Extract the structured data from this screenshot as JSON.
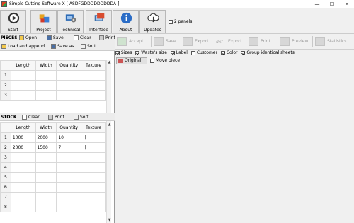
{
  "window": {
    "title": "Simple Cutting Software X [ ASDFGDDDDDDDDDA ]",
    "minimize": "—",
    "maximize": "☐",
    "close": "✕"
  },
  "ribbon": {
    "buttons": [
      {
        "label": "Start",
        "icon": "play-icon"
      },
      {
        "label": "Project",
        "icon": "project-icon"
      },
      {
        "label": "Technical",
        "icon": "technical-icon"
      },
      {
        "label": "Interface",
        "icon": "interface-icon"
      },
      {
        "label": "About",
        "icon": "info-icon"
      },
      {
        "label": "Updates",
        "icon": "cloud-update-icon"
      }
    ],
    "two_panels_label": "2 panels"
  },
  "pieces": {
    "section_label": "PIECES",
    "toolbar": {
      "open": "Open",
      "save": "Save",
      "clear": "Clear",
      "print": "Print",
      "load_append": "Load and append",
      "save_as": "Save as",
      "sort": "Sort"
    },
    "columns": [
      "Length",
      "Width",
      "Quantity",
      "Texture"
    ],
    "rows": [
      {
        "num": "1",
        "length": "",
        "width": "",
        "quantity": "",
        "texture": ""
      },
      {
        "num": "2",
        "length": "",
        "width": "",
        "quantity": "",
        "texture": ""
      },
      {
        "num": "3",
        "length": "",
        "width": "",
        "quantity": "",
        "texture": ""
      }
    ]
  },
  "stock": {
    "section_label": "STOCK",
    "toolbar": {
      "clear": "Clear",
      "print": "Print",
      "sort": "Sort"
    },
    "columns": [
      "Length",
      "Width",
      "Quantity",
      "Texture"
    ],
    "rows": [
      {
        "num": "1",
        "length": "1000",
        "width": "2000",
        "quantity": "10",
        "texture": "||"
      },
      {
        "num": "2",
        "length": "2000",
        "width": "1500",
        "quantity": "7",
        "texture": "||"
      },
      {
        "num": "3",
        "length": "",
        "width": "",
        "quantity": "",
        "texture": ""
      },
      {
        "num": "4",
        "length": "",
        "width": "",
        "quantity": "",
        "texture": ""
      },
      {
        "num": "5",
        "length": "",
        "width": "",
        "quantity": "",
        "texture": ""
      },
      {
        "num": "6",
        "length": "",
        "width": "",
        "quantity": "",
        "texture": ""
      },
      {
        "num": "7",
        "length": "",
        "width": "",
        "quantity": "",
        "texture": ""
      },
      {
        "num": "8",
        "length": "",
        "width": "",
        "quantity": "",
        "texture": ""
      }
    ]
  },
  "results_toolbar": {
    "accept": "Accept",
    "save": "Save",
    "export": "Export",
    "export_dxf": "Export",
    "print": "Print",
    "preview": "Preview",
    "statistics": "Statistics"
  },
  "options": {
    "sizes": "Sizes",
    "wastes_size": "Waste's size",
    "label": "Label",
    "customer": "Customer",
    "color": "Color",
    "group_identical": "Group identical sheets"
  },
  "view": {
    "original": "Original",
    "move_piece": "Move piece"
  },
  "colors": {
    "window_bg": "#f0f0f0",
    "grid_line": "#d9d9d9",
    "disabled_text": "#9a9a9a"
  }
}
